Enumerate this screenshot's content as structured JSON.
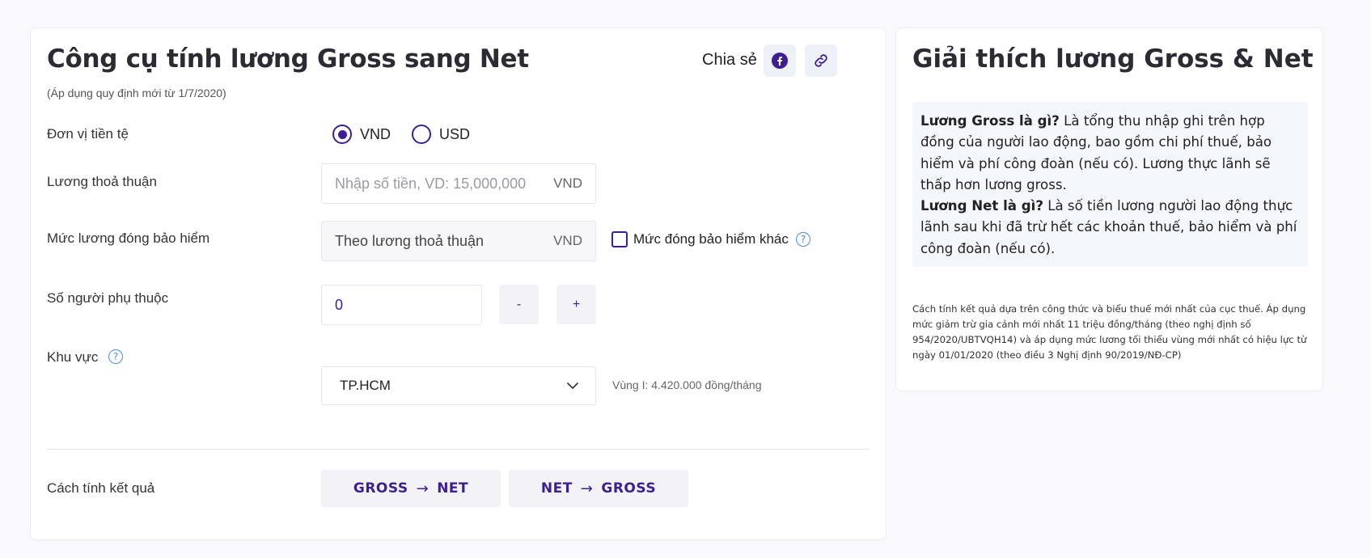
{
  "calculator": {
    "title": "Công cụ tính lương Gross sang Net",
    "subtitle": "(Áp dụng quy định mới từ 1/7/2020)",
    "share": {
      "label": "Chia sẻ",
      "facebook_icon": "facebook-icon",
      "link_icon": "link-icon"
    },
    "currency": {
      "label": "Đơn vị tiền tệ",
      "options": [
        {
          "label": "VND",
          "selected": true
        },
        {
          "label": "USD",
          "selected": false
        }
      ]
    },
    "salary": {
      "label": "Lương thoả thuận",
      "value": "",
      "placeholder": "Nhập số tiền, VD: 15,000,000",
      "unit": "VND"
    },
    "insurance": {
      "label": "Mức lương đóng bảo hiểm",
      "value": "Theo lương thoả thuận",
      "unit": "VND",
      "other_label": "Mức đóng bảo hiểm khác",
      "other_checked": false
    },
    "dependents": {
      "label": "Số người phụ thuộc",
      "value": "0",
      "minus": "-",
      "plus": "+"
    },
    "region": {
      "label": "Khu vực",
      "selected": "TP.HCM",
      "note": "Vùng I: 4.420.000 đồng/tháng"
    },
    "method": {
      "label": "Cách tính kết quả",
      "gross_to_net": {
        "left": "GROSS",
        "right": "NET"
      },
      "net_to_gross": {
        "left": "NET",
        "right": "GROSS"
      }
    }
  },
  "explanation": {
    "title": "Giải thích lương Gross & Net",
    "gross_q": "Lương Gross là gì?",
    "gross_a": " Là tổng thu nhập ghi trên hợp đồng của người lao động, bao gồm chi phí thuế, bảo hiểm và phí công đoàn (nếu có). Lương thực lãnh sẽ thấp hơn lương gross.",
    "net_q": "Lương Net là gì?",
    "net_a": " Là số tiền lương người lao động thực lãnh sau khi đã trừ hết các khoản thuế, bảo hiểm và phí công đoàn (nếu có).",
    "footnote": "Cách tính kết quả dựa trên công thức và biểu thuế mới nhất của cục thuế. Áp dụng mức giảm trừ gia cảnh mới nhất 11 triệu đồng/tháng (theo nghị định số 954/2020/UBTVQH14) và áp dụng mức lương tối thiểu vùng mới nhất có hiệu lực từ ngày 01/01/2020 (theo điều 3 Nghị định 90/2019/NĐ-CP)"
  },
  "colors": {
    "primary": "#3e1f93",
    "help": "#4b8fe8",
    "background": "#f8f8fd",
    "explain_bg": "#f4f7fc"
  }
}
